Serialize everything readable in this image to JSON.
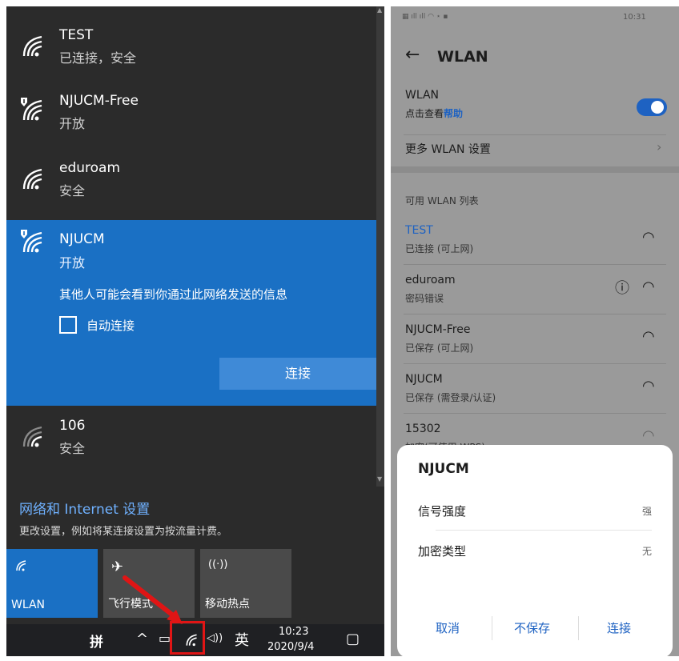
{
  "windows": {
    "networks": [
      {
        "name": "TEST",
        "status": "已连接，安全"
      },
      {
        "name": "NJUCM-Free",
        "status": "开放"
      },
      {
        "name": "eduroam",
        "status": "安全"
      },
      {
        "name": "NJUCM",
        "status": "开放"
      },
      {
        "name": "106",
        "status": "安全"
      }
    ],
    "selected_warning": "其他人可能会看到你通过此网络发送的信息",
    "auto_connect_label": "自动连接",
    "connect_button": "连接",
    "network_settings_title": "网络和 Internet 设置",
    "network_settings_sub": "更改设置，例如将某连接设置为按流量计费。",
    "quick_tiles": [
      {
        "label": "WLAN",
        "icon": "wifi-icon"
      },
      {
        "label": "飞行模式",
        "icon": "airplane-icon"
      },
      {
        "label": "移动热点",
        "icon": "hotspot-icon"
      }
    ],
    "taskbar": {
      "ime_grid": "拼",
      "language": "英",
      "volume_glyph": "◁))",
      "time": "10:23",
      "date": "2020/9/4"
    },
    "colors": {
      "selected": "#1a70c4",
      "link": "#6fb1ff",
      "highlight_box": "#e01515"
    }
  },
  "android": {
    "status_bar": {
      "time": "10:31"
    },
    "title": "WLAN",
    "wlan_toggle": {
      "label": "WLAN",
      "help_prefix": "点击查看",
      "help_link": "帮助",
      "on": true
    },
    "more_settings": "更多 WLAN 设置",
    "list_header": "可用 WLAN 列表",
    "networks": [
      {
        "name": "TEST",
        "status": "已连接 (可上网)",
        "connected": true
      },
      {
        "name": "eduroam",
        "status": "密码错误"
      },
      {
        "name": "NJUCM-Free",
        "status": "已保存 (可上网)"
      },
      {
        "name": "NJUCM",
        "status": "已保存 (需登录/认证)"
      },
      {
        "name": "15302",
        "status": "加密(可使用 WPS)"
      }
    ],
    "dialog": {
      "title": "NJUCM",
      "rows": [
        {
          "label": "信号强度",
          "value": "强"
        },
        {
          "label": "加密类型",
          "value": "无"
        }
      ],
      "buttons": {
        "cancel": "取消",
        "forget": "不保存",
        "connect": "连接"
      }
    },
    "colors": {
      "accent": "#1e62c2"
    }
  }
}
